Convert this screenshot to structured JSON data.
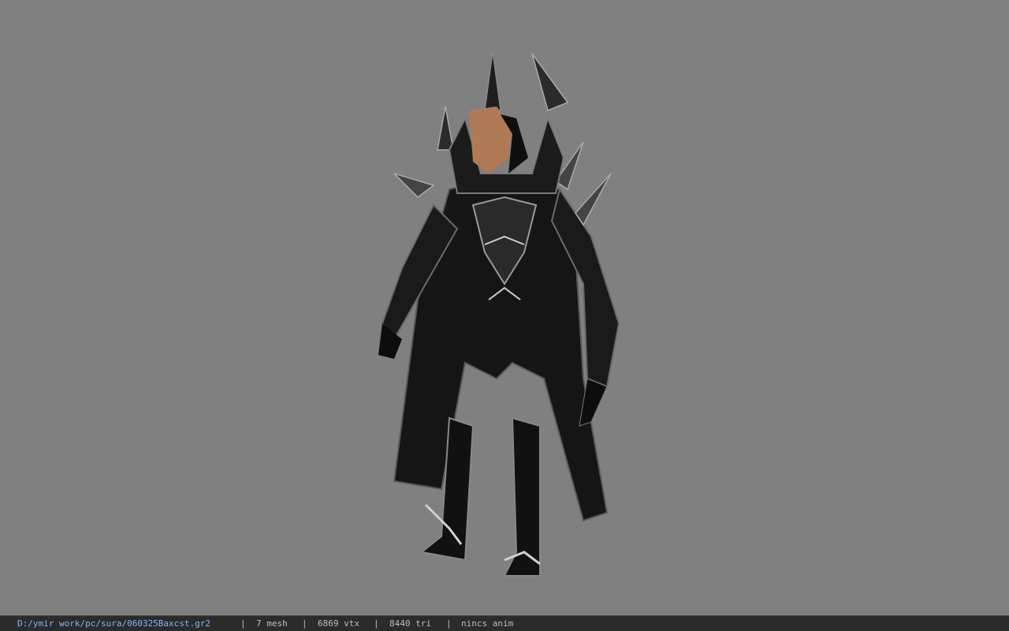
{
  "viewer": {
    "background_color": "#808080",
    "model_icon": "armored-character-model"
  },
  "statusbar": {
    "file_path": "D:/ymir work/pc/sura/060325Baxcst.gr2",
    "separator": "|",
    "mesh": "7 mesh",
    "vtx": "6869 vtx",
    "tri": "8440 tri",
    "anim": "nincs anim",
    "colors": {
      "background": "#2b2b2b",
      "path": "#7fb6ff",
      "text": "#bdbdbd"
    }
  }
}
